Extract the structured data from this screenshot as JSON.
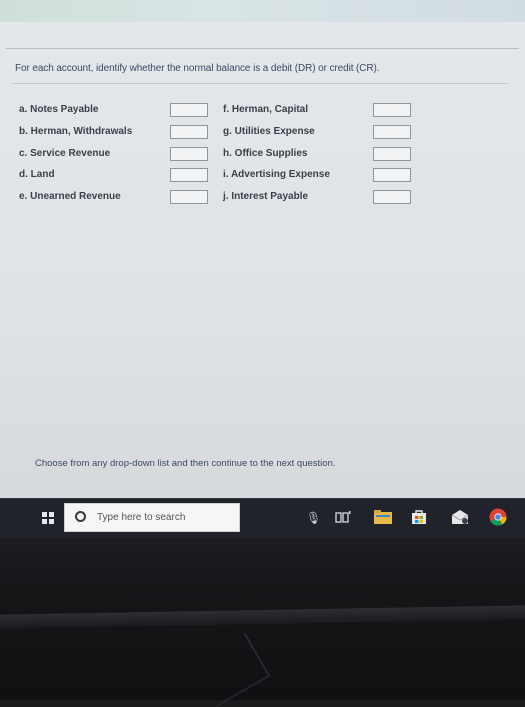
{
  "instruction": "For each account, identify whether the normal balance is a debit (DR) or credit (CR).",
  "accounts_left": [
    {
      "label": "a. Notes Payable"
    },
    {
      "label": "b. Herman, Withdrawals"
    },
    {
      "label": "c. Service Revenue"
    },
    {
      "label": "d. Land"
    },
    {
      "label": "e. Unearned Revenue"
    }
  ],
  "accounts_right": [
    {
      "label": "f. Herman, Capital"
    },
    {
      "label": "g. Utilities Expense"
    },
    {
      "label": "h. Office Supplies"
    },
    {
      "label": "i. Advertising Expense"
    },
    {
      "label": "j. Interest Payable"
    }
  ],
  "footer": "Choose from any drop-down list and then continue to the next question.",
  "taskbar": {
    "search_placeholder": "Type here to search"
  },
  "colors": {
    "text_blue": "#3b4a63",
    "taskbar_bg": "#20232a"
  }
}
